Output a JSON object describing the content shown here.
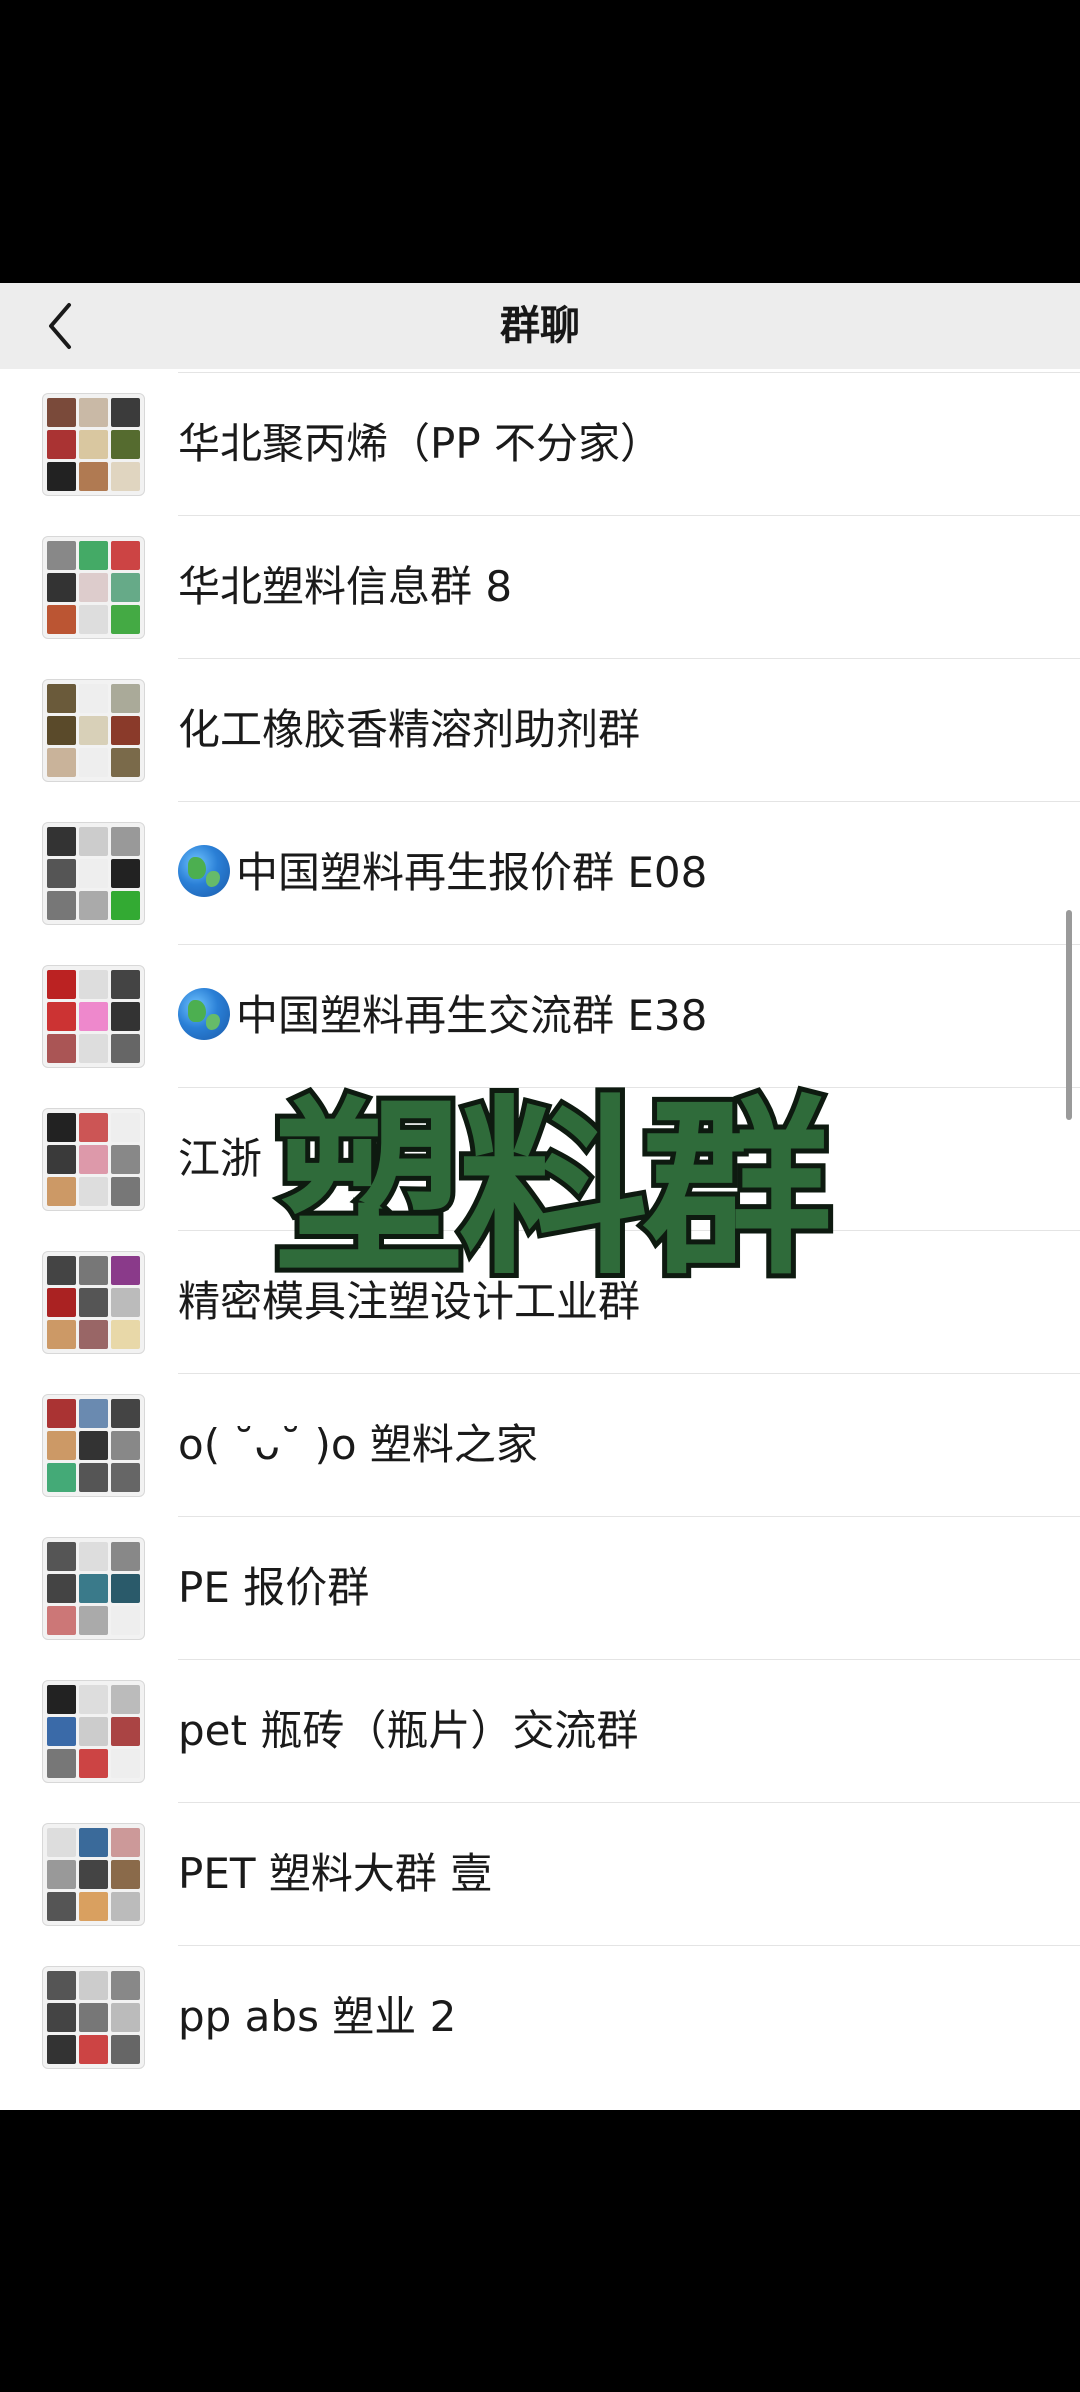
{
  "nav": {
    "title": "群聊",
    "back_icon": "chevron-left-icon"
  },
  "groups": [
    {
      "name": "华北聚丙烯（PP 不分家）",
      "emoji": false
    },
    {
      "name": "华北塑料信息群 8",
      "emoji": false
    },
    {
      "name": "化工橡胶香精溶剂助剂群",
      "emoji": false
    },
    {
      "name": "中国塑料再生报价群 E08",
      "emoji": true
    },
    {
      "name": "中国塑料再生交流群 E38",
      "emoji": true
    },
    {
      "name": "江浙",
      "emoji": false
    },
    {
      "name": "精密模具注塑设计工业群",
      "emoji": false
    },
    {
      "name": "o( ˘ᴗ˘ )o 塑料之家",
      "emoji": false
    },
    {
      "name": "PE 报价群",
      "emoji": false
    },
    {
      "name": "pet 瓶砖（瓶片）交流群",
      "emoji": false
    },
    {
      "name": "PET 塑料大群 壹",
      "emoji": false
    },
    {
      "name": "pp abs 塑业 2",
      "emoji": false
    }
  ],
  "overlay": {
    "text": "塑料群",
    "color": "#2f6b3a"
  },
  "colors": {
    "nav_bg": "#ededed",
    "list_bg": "#ffffff",
    "separator": "#e4e4e4"
  }
}
